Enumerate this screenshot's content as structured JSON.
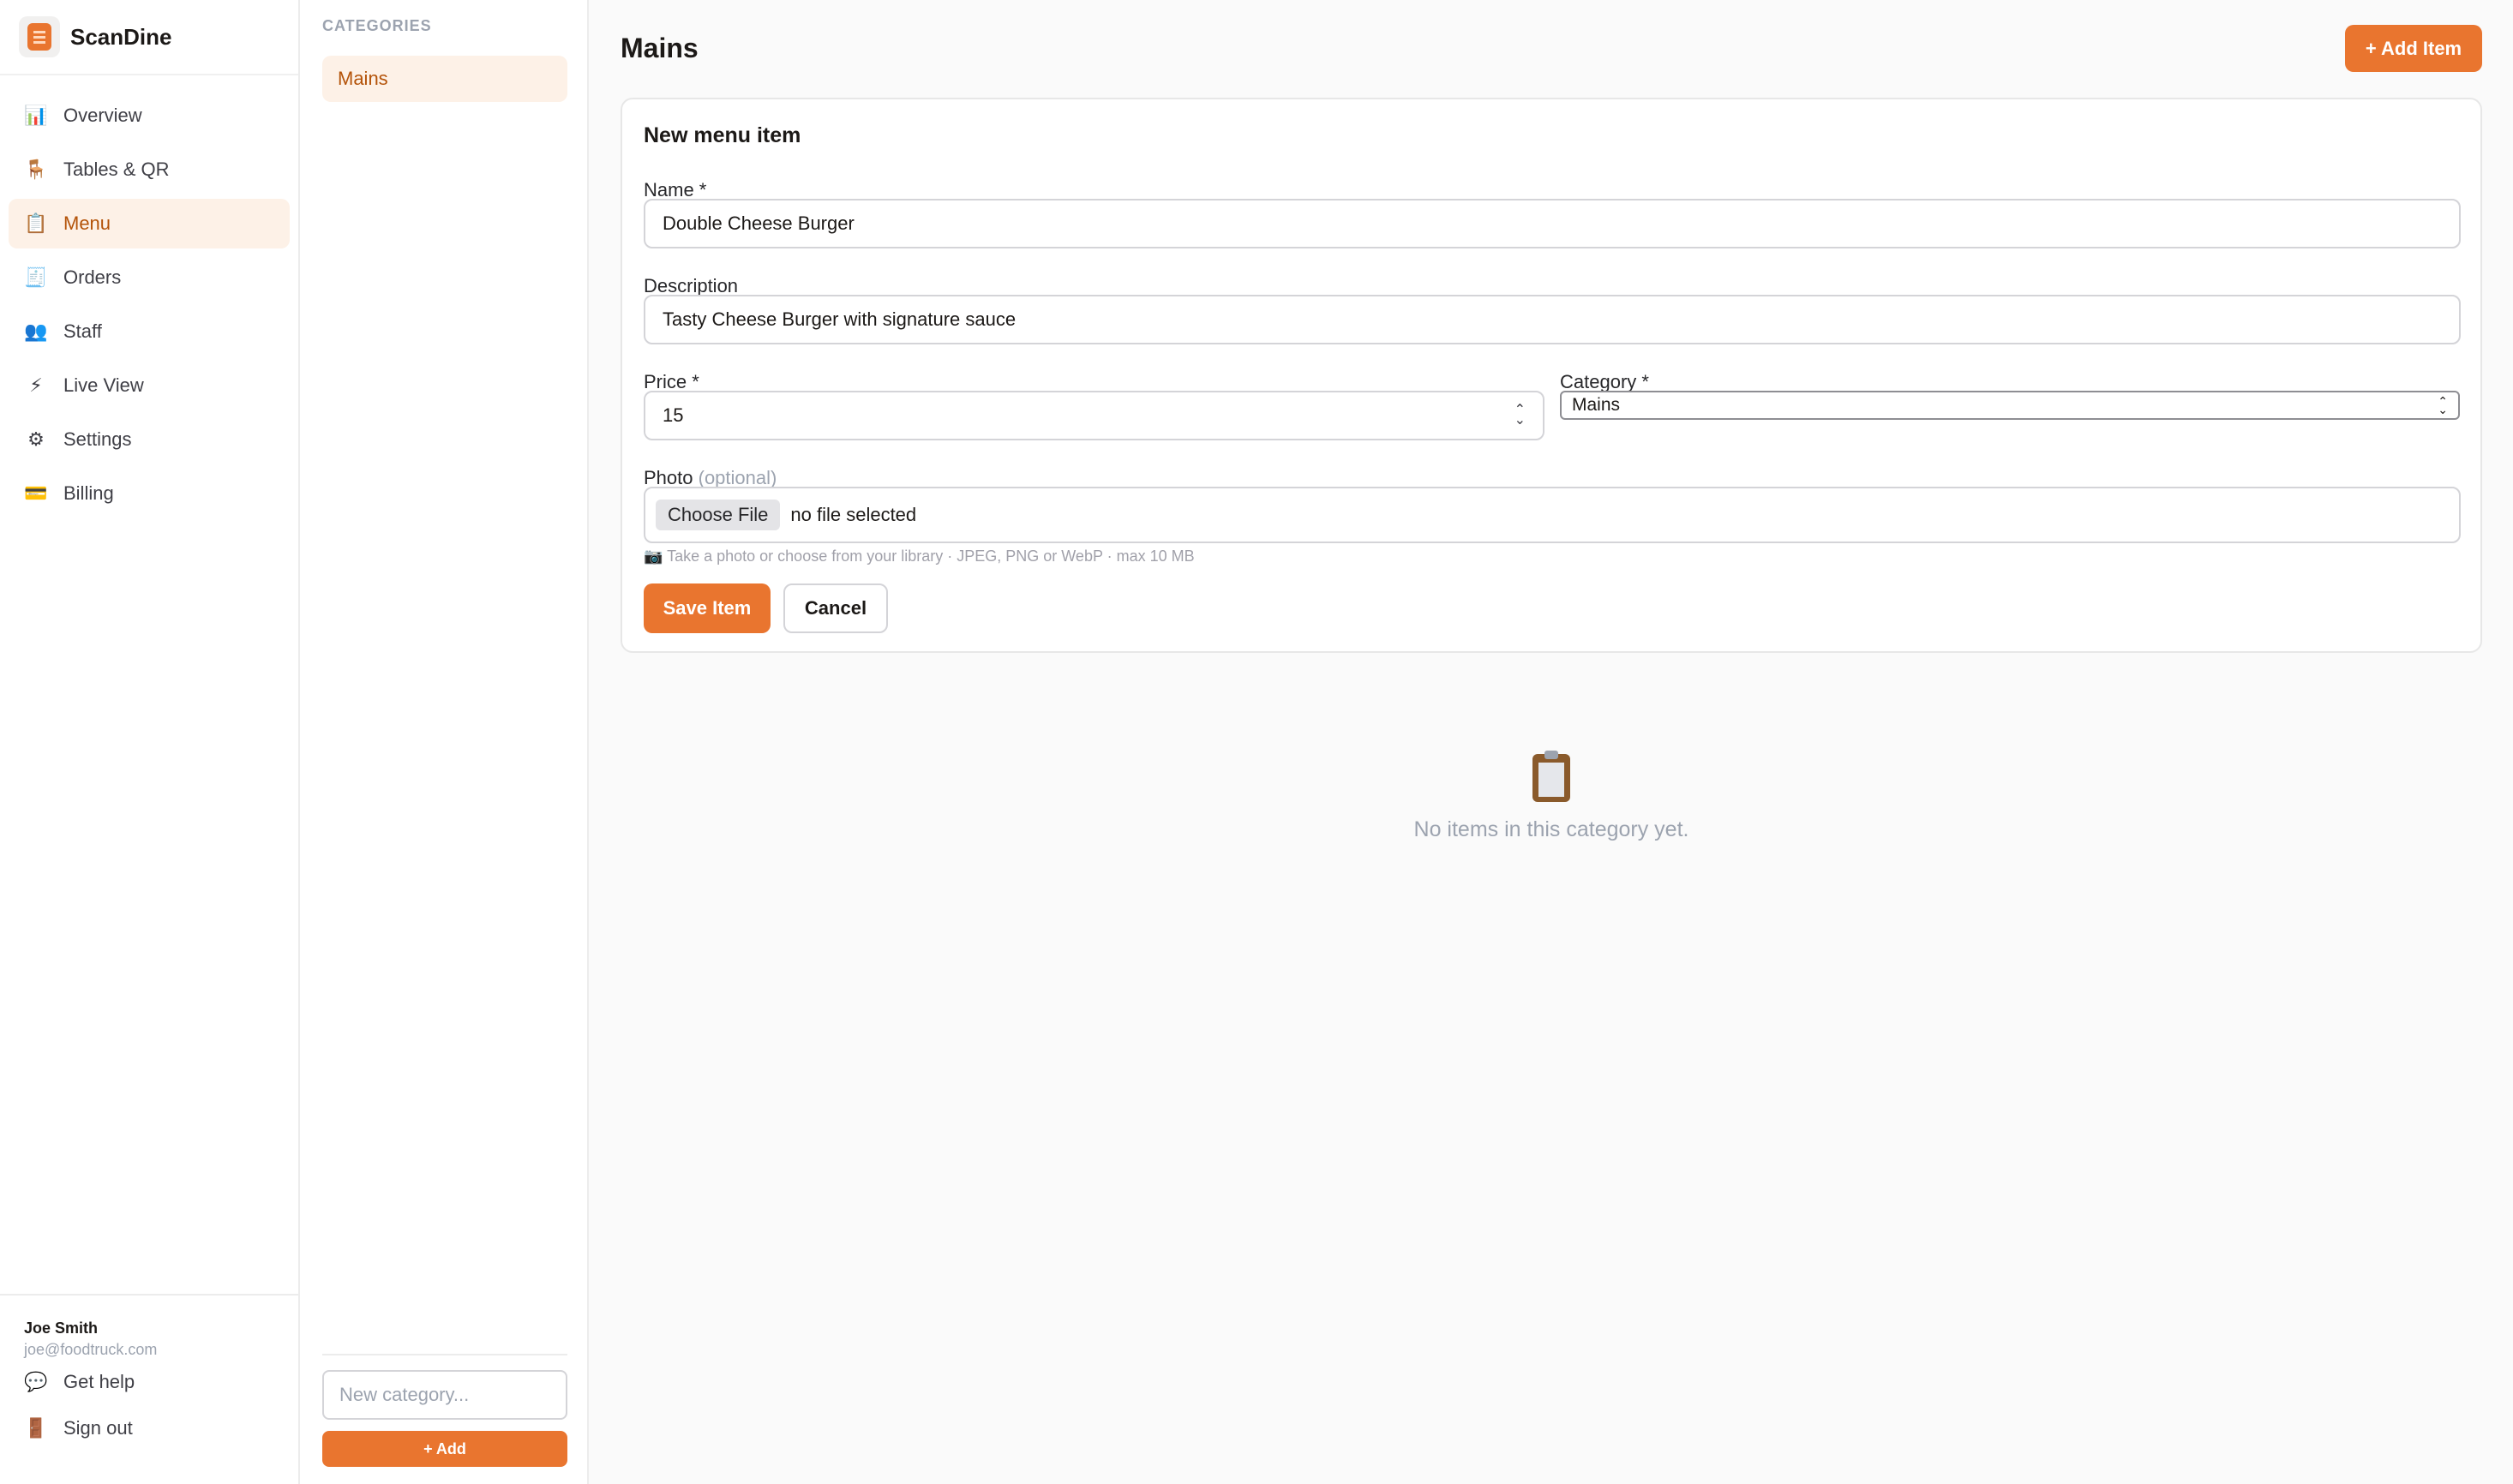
{
  "brand": {
    "name": "ScanDine",
    "logo_icon": "menu-card-icon"
  },
  "nav": {
    "items": [
      {
        "label": "Overview",
        "icon": "📊",
        "icon_name": "bar-chart-icon"
      },
      {
        "label": "Tables & QR",
        "icon": "🪑",
        "icon_name": "chair-icon"
      },
      {
        "label": "Menu",
        "icon": "📋",
        "icon_name": "menu-icon",
        "active": true
      },
      {
        "label": "Orders",
        "icon": "🧾",
        "icon_name": "receipt-icon"
      },
      {
        "label": "Staff",
        "icon": "👥",
        "icon_name": "people-icon"
      },
      {
        "label": "Live View",
        "icon": "⚡",
        "icon_name": "lightning-icon"
      },
      {
        "label": "Settings",
        "icon": "⚙",
        "icon_name": "gear-icon"
      },
      {
        "label": "Billing",
        "icon": "💳",
        "icon_name": "credit-card-icon"
      }
    ]
  },
  "user": {
    "name": "Joe Smith",
    "email": "joe@foodtruck.com",
    "help_label": "Get help",
    "help_icon": "💬",
    "signout_label": "Sign out",
    "signout_icon": "🚪"
  },
  "categories": {
    "heading": "CATEGORIES",
    "items": [
      "Mains"
    ],
    "new_placeholder": "New category...",
    "add_label": "+ Add"
  },
  "main": {
    "title": "Mains",
    "add_item_label": "+ Add Item",
    "form": {
      "title": "New menu item",
      "name_label": "Name *",
      "name_value": "Double Cheese Burger",
      "description_label": "Description",
      "description_value": "Tasty Cheese Burger with signature sauce",
      "price_label": "Price *",
      "price_value": "15",
      "category_label": "Category *",
      "category_value": "Mains",
      "photo_label": "Photo",
      "photo_optional": "(optional)",
      "choose_file_label": "Choose File",
      "file_status": "no file selected",
      "hint": "📷 Take a photo or choose from your library · JPEG, PNG or WebP · max 10 MB",
      "save_label": "Save Item",
      "cancel_label": "Cancel"
    },
    "empty_text": "No items in this category yet."
  },
  "colors": {
    "accent": "#e9752f",
    "active_bg": "#fdf1e7",
    "active_text": "#b45309"
  }
}
